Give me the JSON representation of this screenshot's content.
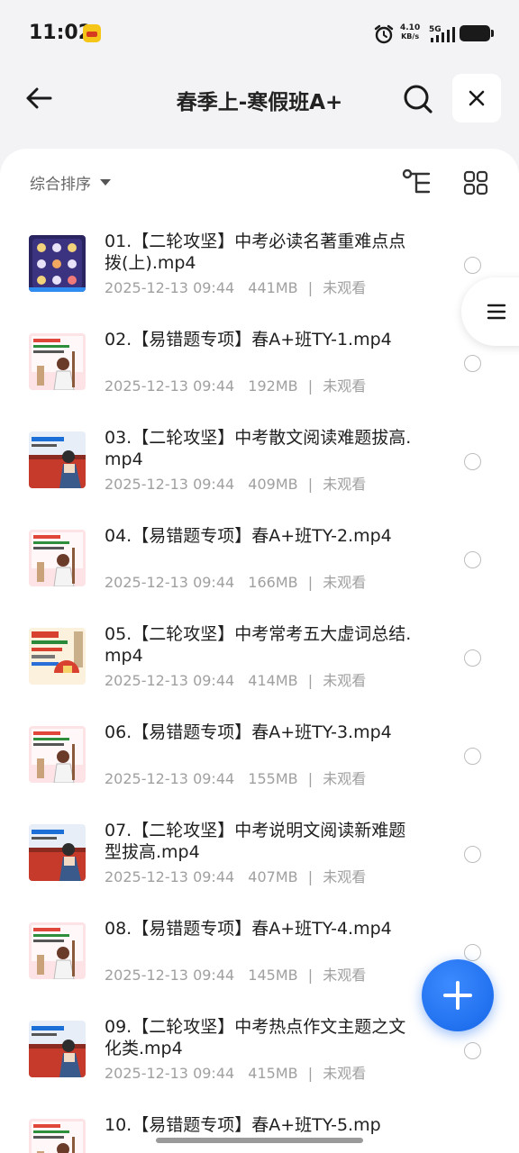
{
  "status_bar": {
    "time": "11:02",
    "net_speed_value": "4.10",
    "net_speed_unit": "KB/s",
    "network_type": "5G"
  },
  "header": {
    "title": "春季上-寒假班A+",
    "back_icon": "arrow-left-icon",
    "search_icon": "search-icon",
    "close_icon": "close-icon"
  },
  "toolbar": {
    "sort_label": "综合排序",
    "tree_icon": "tree-view-icon",
    "grid_icon": "grid-view-icon"
  },
  "files": [
    {
      "name": "01.【二轮攻坚】中考必读名著重难点点拨(上).mp4",
      "date": "2025-12-13 09:44",
      "size": "441MB",
      "status": "未观看",
      "thumb": "dark"
    },
    {
      "name": "02.【易错题专项】春A+班TY-1.mp4",
      "date": "2025-12-13 09:44",
      "size": "192MB",
      "status": "未观看",
      "thumb": "pink"
    },
    {
      "name": "03.【二轮攻坚】中考散文阅读难题拔高.mp4",
      "date": "2025-12-13 09:44",
      "size": "409MB",
      "status": "未观看",
      "thumb": "red"
    },
    {
      "name": "04.【易错题专项】春A+班TY-2.mp4",
      "date": "2025-12-13 09:44",
      "size": "166MB",
      "status": "未观看",
      "thumb": "pink"
    },
    {
      "name": "05.【二轮攻坚】中考常考五大虚词总结.mp4",
      "date": "2025-12-13 09:44",
      "size": "414MB",
      "status": "未观看",
      "thumb": "cream"
    },
    {
      "name": "06.【易错题专项】春A+班TY-3.mp4",
      "date": "2025-12-13 09:44",
      "size": "155MB",
      "status": "未观看",
      "thumb": "pink"
    },
    {
      "name": "07.【二轮攻坚】中考说明文阅读新难题型拔高.mp4",
      "date": "2025-12-13 09:44",
      "size": "407MB",
      "status": "未观看",
      "thumb": "red"
    },
    {
      "name": "08.【易错题专项】春A+班TY-4.mp4",
      "date": "2025-12-13 09:44",
      "size": "145MB",
      "status": "未观看",
      "thumb": "pink"
    },
    {
      "name": "09.【二轮攻坚】中考热点作文主题之文化类.mp4",
      "date": "2025-12-13 09:44",
      "size": "415MB",
      "status": "未观看",
      "thumb": "red"
    },
    {
      "name": "10.【易错题专项】春A+班TY-5.mp",
      "date": "",
      "size": "",
      "status": "",
      "thumb": "pink"
    }
  ],
  "fab": {
    "icon": "plus-icon"
  },
  "side_handle": {
    "icon": "menu-icon"
  },
  "colors": {
    "accent": "#1565e8",
    "background": "#f3f3f5",
    "meta_text": "#a0a0a0"
  }
}
